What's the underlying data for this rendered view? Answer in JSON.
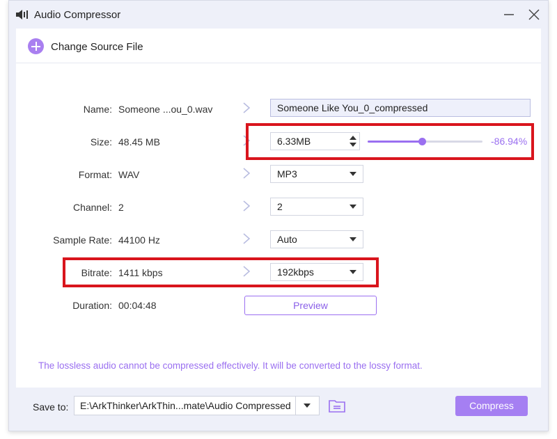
{
  "window": {
    "title": "Audio Compressor"
  },
  "toolbar": {
    "change_source_label": "Change Source File"
  },
  "fields": {
    "name": {
      "label": "Name:",
      "source": "Someone ...ou_0.wav",
      "output": "Someone Like You_0_compressed"
    },
    "size": {
      "label": "Size:",
      "source": "48.45 MB",
      "output": "6.33MB",
      "reduction": "-86.94%",
      "slider_fraction": 0.47
    },
    "format": {
      "label": "Format:",
      "source": "WAV",
      "selected": "MP3"
    },
    "channel": {
      "label": "Channel:",
      "source": "2",
      "selected": "2"
    },
    "sample_rate": {
      "label": "Sample Rate:",
      "source": "44100 Hz",
      "selected": "Auto"
    },
    "bitrate": {
      "label": "Bitrate:",
      "source": "1411 kbps",
      "selected": "192kbps"
    },
    "duration": {
      "label": "Duration:",
      "source": "00:04:48"
    }
  },
  "preview_label": "Preview",
  "notice": "The lossless audio cannot be compressed effectively. It will be converted to the lossy format.",
  "footer": {
    "save_to_label": "Save to:",
    "path": "E:\\ArkThinker\\ArkThin...mate\\Audio Compressed",
    "compress_label": "Compress"
  },
  "colors": {
    "accent": "#9a6ff0",
    "highlight": "#d9151d"
  }
}
